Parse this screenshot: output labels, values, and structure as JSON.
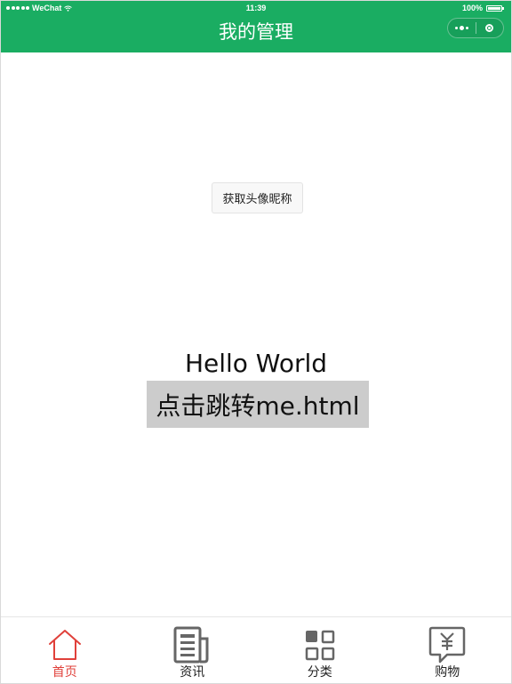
{
  "status_bar": {
    "carrier": "WeChat",
    "time": "11:39",
    "battery": "100%"
  },
  "nav": {
    "title": "我的管理"
  },
  "main": {
    "avatar_button_label": "获取头像昵称",
    "greeting": "Hello World",
    "jump_text": "点击跳转me.html"
  },
  "tabbar": {
    "active_index": 0,
    "active_color": "#e0403a",
    "items": [
      {
        "label": "首页",
        "icon": "home-icon"
      },
      {
        "label": "资讯",
        "icon": "news-icon"
      },
      {
        "label": "分类",
        "icon": "category-icon"
      },
      {
        "label": "购物",
        "icon": "shopping-icon"
      }
    ]
  },
  "colors": {
    "nav_background": "#1aad62",
    "jump_background": "#cccccc"
  }
}
